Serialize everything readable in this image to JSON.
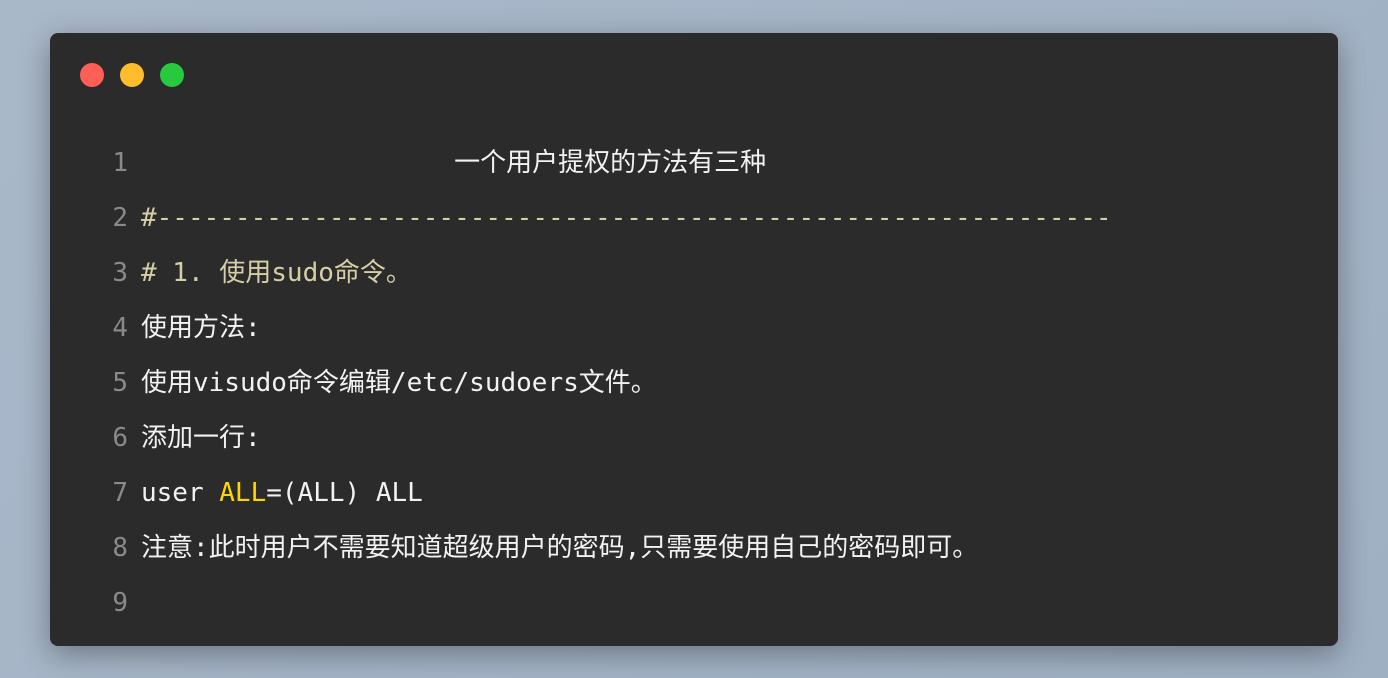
{
  "window": {
    "controls": [
      "close",
      "minimize",
      "maximize"
    ],
    "colors": {
      "close": "#ff5f56",
      "minimize": "#ffbd2e",
      "maximize": "#27c93f"
    }
  },
  "lines": [
    {
      "n": "1",
      "text": "                    一个用户提权的方法有三种"
    },
    {
      "n": "2",
      "text": "#-------------------------------------------------------------"
    },
    {
      "n": "3",
      "text": "# 1. 使用sudo命令。"
    },
    {
      "n": "4",
      "text": "使用方法:"
    },
    {
      "n": "5",
      "text": "使用visudo命令编辑/etc/sudoers文件。"
    },
    {
      "n": "6",
      "text": "添加一行:"
    },
    {
      "n": "7",
      "a": "user ",
      "kw": "ALL",
      "b": "=(ALL) ALL"
    },
    {
      "n": "8",
      "text": "注意:此时用户不需要知道超级用户的密码,只需要使用自己的密码即可。"
    },
    {
      "n": "9",
      "text": ""
    }
  ],
  "colors": {
    "background": "#2b2b2b",
    "comment": "#d6cfa6",
    "keyword": "#ffd700",
    "text": "#f2f2f2",
    "line_number": "#8a8a8a"
  }
}
